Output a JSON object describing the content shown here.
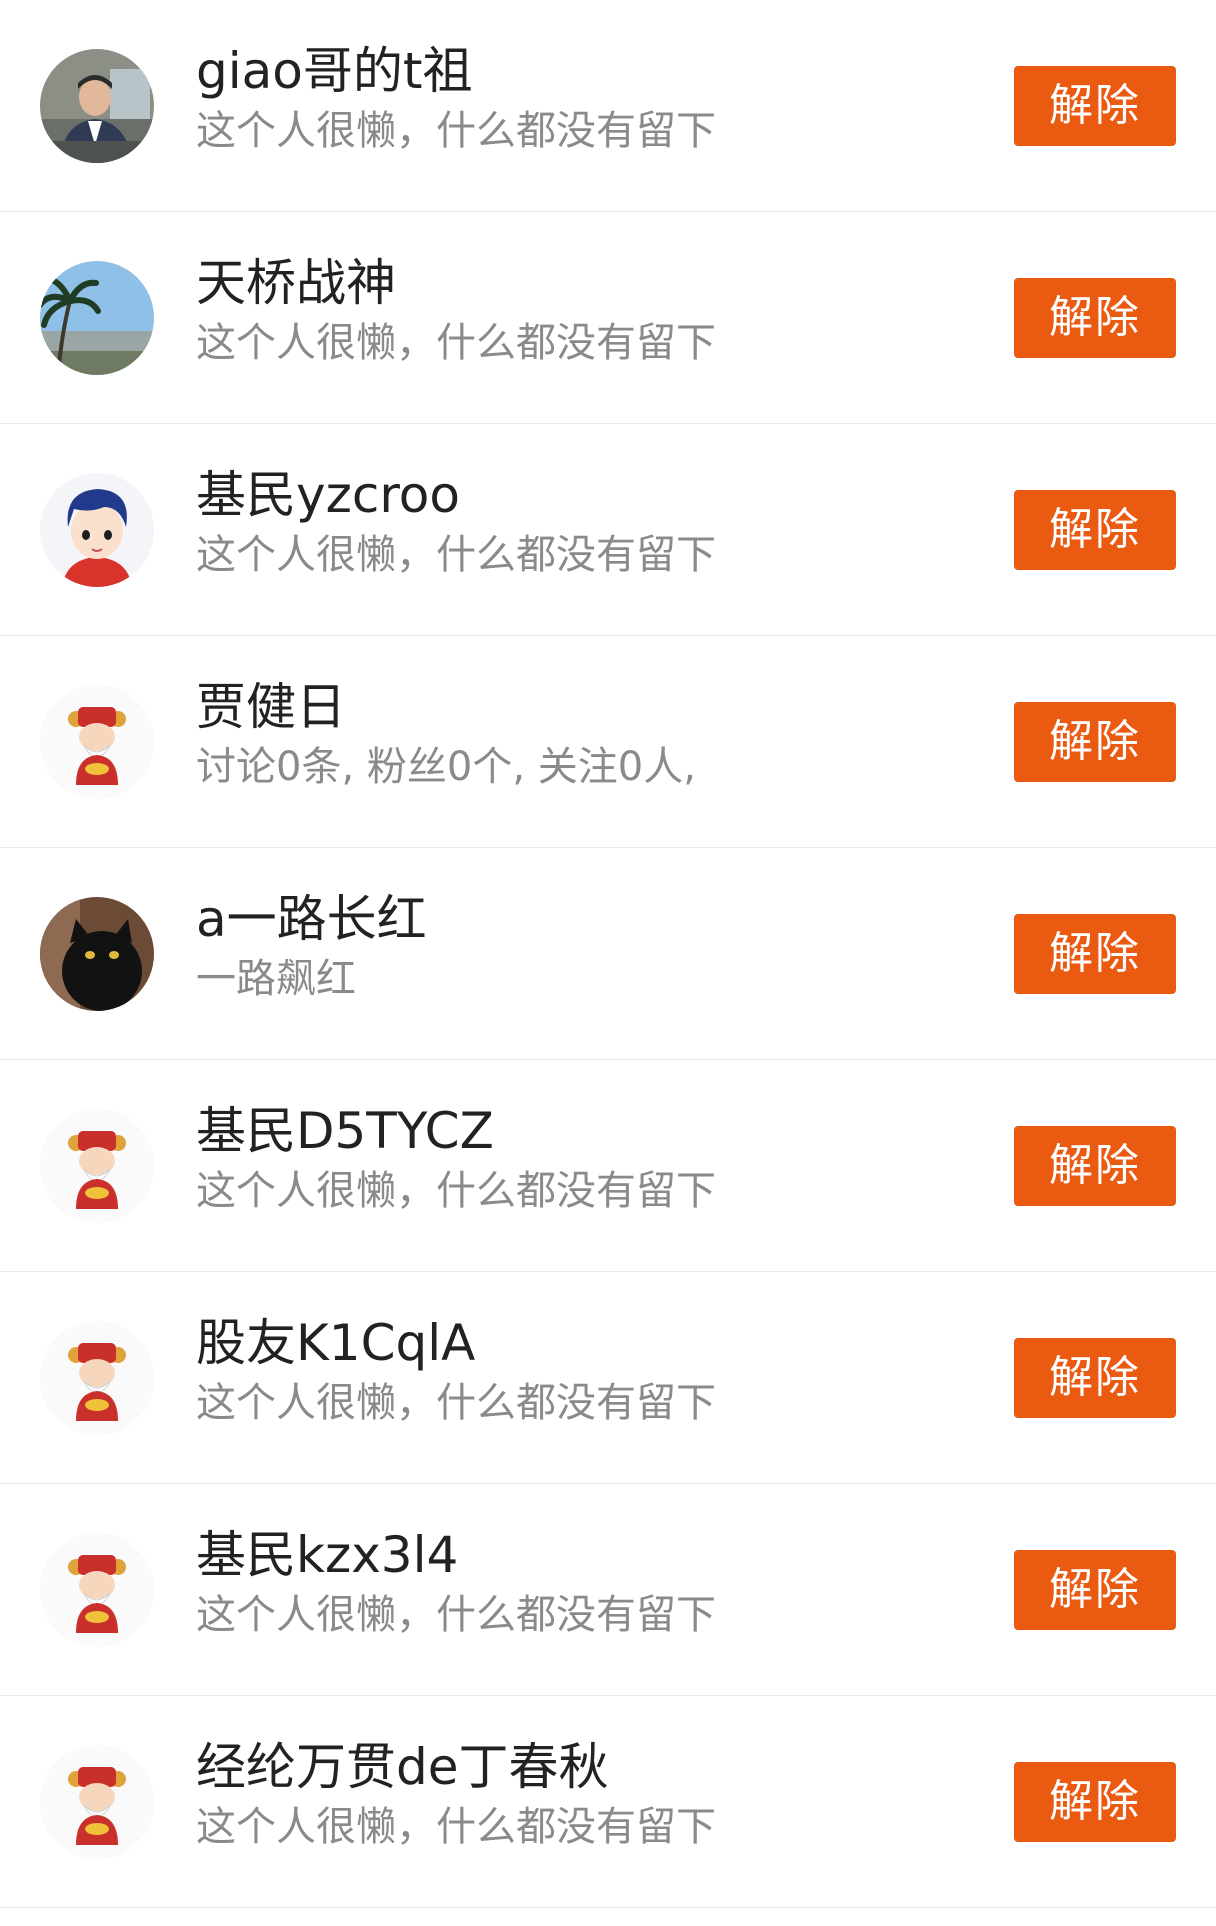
{
  "button_label": "解除",
  "colors": {
    "accent": "#ea5a10",
    "name_text": "#222222",
    "bio_text": "#8a8a8a",
    "divider": "#ececec"
  },
  "users": [
    {
      "name": "giao哥的t祖",
      "bio": "这个人很懒，什么都没有留下",
      "avatar": "photo-man-avatar"
    },
    {
      "name": "天桥战神",
      "bio": "这个人很懒，什么都没有留下",
      "avatar": "palm-beach-avatar"
    },
    {
      "name": "基民yzcroo",
      "bio": "这个人很懒，什么都没有留下",
      "avatar": "cartoon-boy-avatar"
    },
    {
      "name": "贾健日",
      "bio": "讨论0条, 粉丝0个, 关注0人,",
      "avatar": "fortune-god-avatar"
    },
    {
      "name": "a一路长红",
      "bio": "一路飙红",
      "avatar": "black-cat-avatar"
    },
    {
      "name": "基民D5TYCZ",
      "bio": "这个人很懒，什么都没有留下",
      "avatar": "fortune-god-avatar"
    },
    {
      "name": "股友K1CqlA",
      "bio": "这个人很懒，什么都没有留下",
      "avatar": "fortune-god-avatar"
    },
    {
      "name": "基民kzx3l4",
      "bio": "这个人很懒，什么都没有留下",
      "avatar": "fortune-god-avatar"
    },
    {
      "name": "经纶万贯de丁春秋",
      "bio": "这个人很懒，什么都没有留下",
      "avatar": "fortune-god-avatar"
    }
  ]
}
